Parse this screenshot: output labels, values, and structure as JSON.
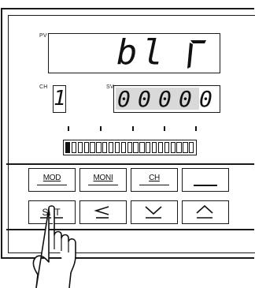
{
  "pv": {
    "label": "PV",
    "value": "bl"
  },
  "ch": {
    "label": "CH",
    "value": "1"
  },
  "sv": {
    "label": "SV",
    "digits": [
      "0",
      "0",
      "0",
      "0",
      "0"
    ],
    "highlight_count": 4
  },
  "bar": {
    "level": 0.0
  },
  "buttons": {
    "mod": "MOD",
    "moni": "MONI",
    "ch": "CH",
    "blank": "",
    "set": "SET"
  },
  "colors": {
    "frame": "#1a1a1a",
    "sv_highlight": "#d9d9d9"
  }
}
